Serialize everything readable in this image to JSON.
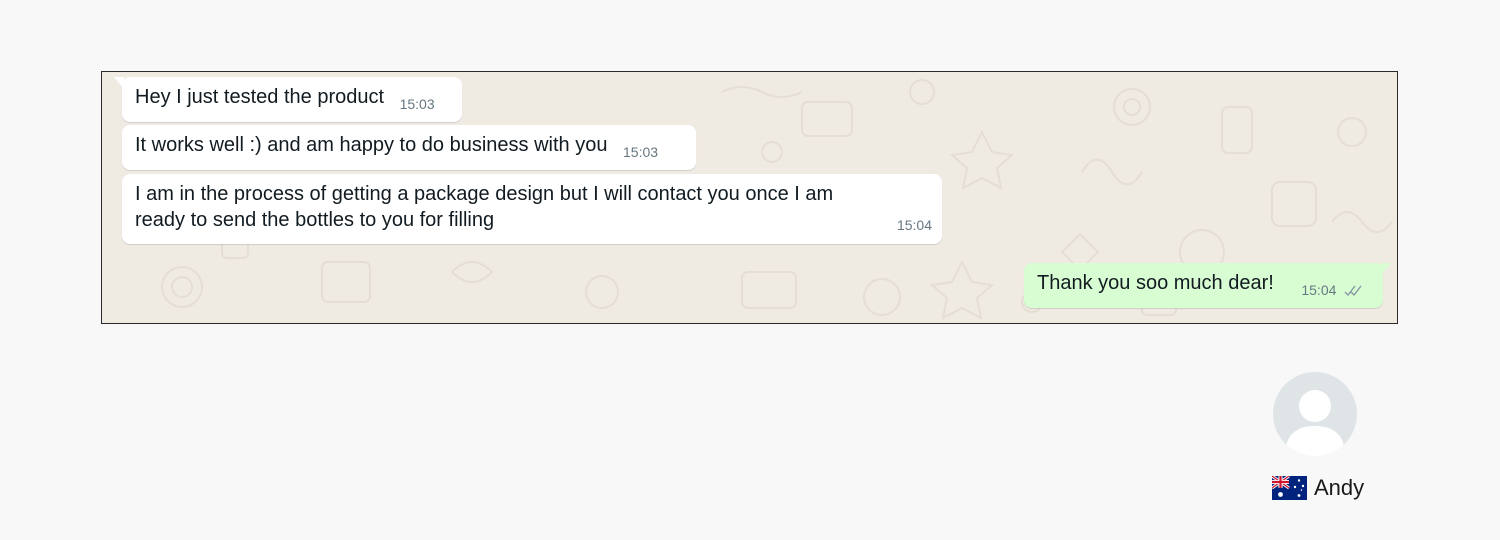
{
  "chat": {
    "messages": [
      {
        "direction": "incoming",
        "text": "Hey I just tested the product",
        "time": "15:03"
      },
      {
        "direction": "incoming",
        "text": "It works well :) and am happy to do business with you",
        "time": "15:03"
      },
      {
        "direction": "incoming",
        "text": "I am in the process of getting a package design but I will contact you once I am ready to send the bottles to you for filling",
        "time": "15:04"
      },
      {
        "direction": "outgoing",
        "text": "Thank you soo much dear!",
        "time": "15:04",
        "status_icon": "double-check-icon"
      }
    ],
    "colors": {
      "wallpaper": "#efeae2",
      "incoming_bubble": "#ffffff",
      "outgoing_bubble": "#d9fdd3",
      "timestamp": "#667781",
      "read_ticks": "#8696a0"
    }
  },
  "contact": {
    "name": "Andy",
    "avatar_icon": "default-avatar-icon",
    "flag_icon": "australia-flag-icon"
  }
}
